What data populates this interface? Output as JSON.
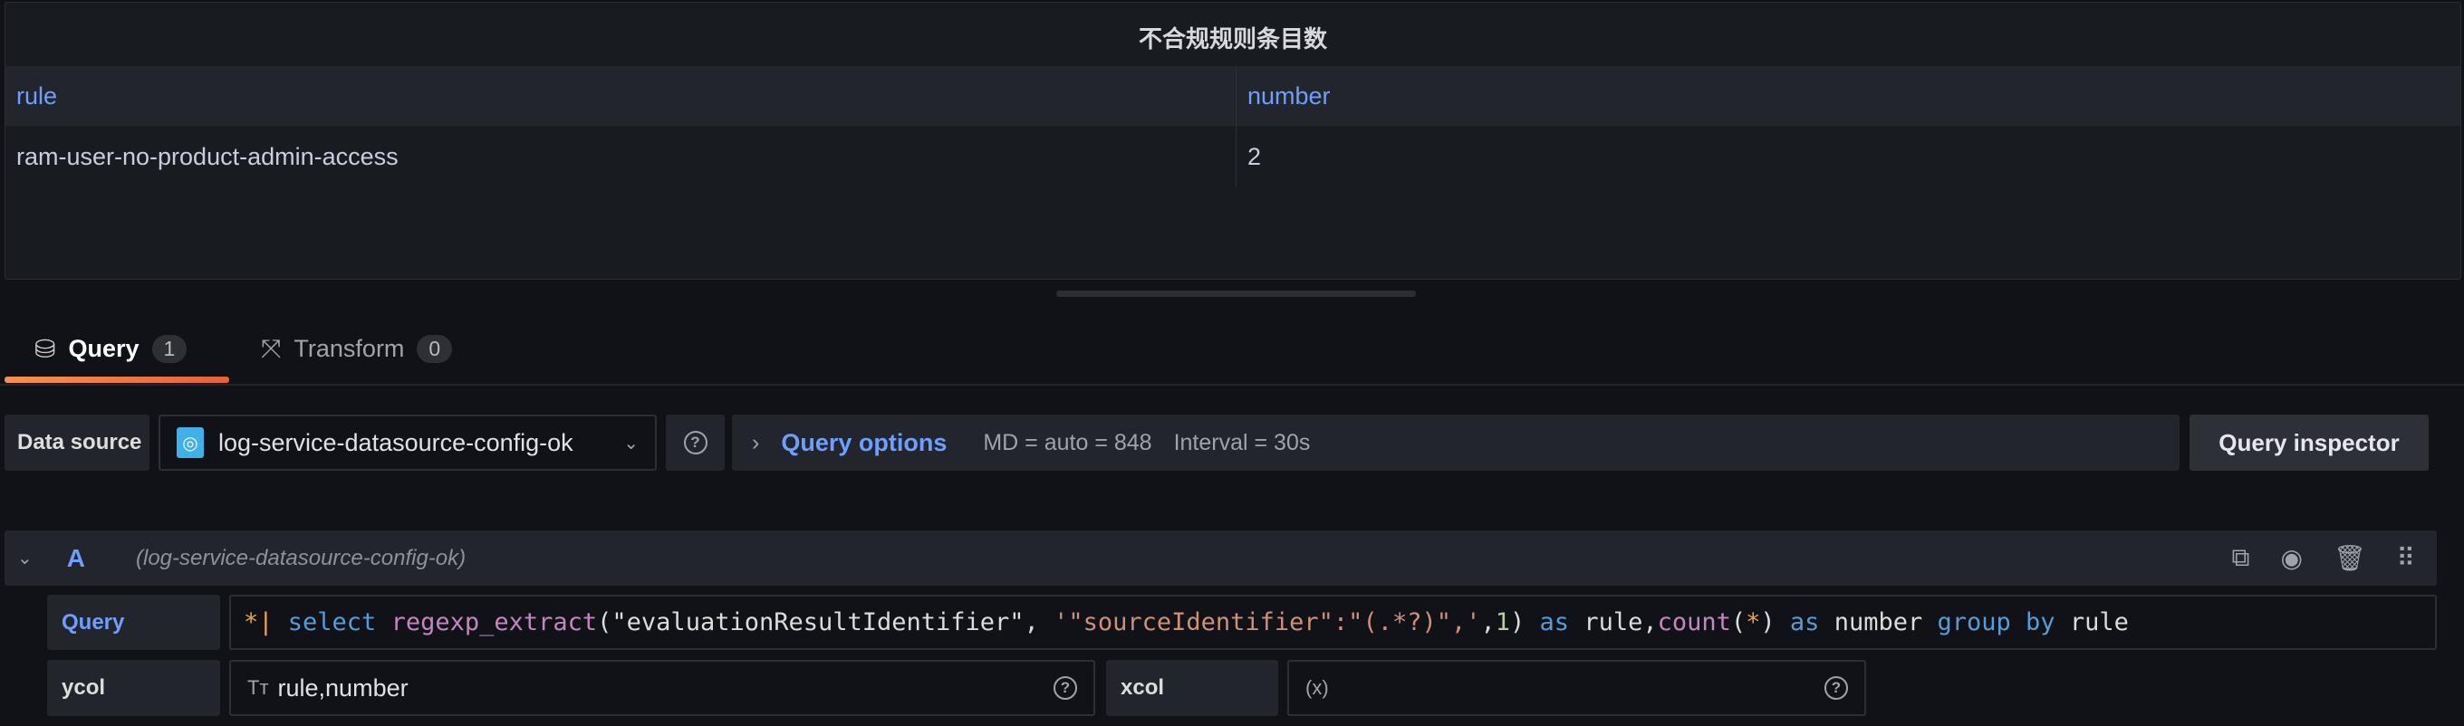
{
  "panel": {
    "title": "不合规规则条目数",
    "columns": [
      "rule",
      "number"
    ],
    "rows": [
      [
        "ram-user-no-product-admin-access",
        "2"
      ]
    ]
  },
  "tabs": [
    {
      "label": "Query",
      "count": "1"
    },
    {
      "label": "Transform",
      "count": "0"
    }
  ],
  "datasource": {
    "label": "Data source",
    "value": "log-service-datasource-config-ok"
  },
  "query_options": {
    "label": "Query options",
    "md": "MD = auto = 848",
    "interval": "Interval = 30s"
  },
  "inspector_label": "Query inspector",
  "query_row": {
    "letter": "A",
    "datasource": "(log-service-datasource-config-ok)"
  },
  "query_field": {
    "label": "Query",
    "tokens": [
      [
        "o",
        "*"
      ],
      [
        "o",
        "| "
      ],
      [
        "k",
        "select "
      ],
      [
        "f",
        "regexp_extract"
      ],
      [
        "w",
        "(\"evaluationResultIdentifier\", "
      ],
      [
        "s",
        "'\"sourceIdentifier\":\"(.*?)\",'"
      ],
      [
        "w",
        ","
      ],
      [
        "n",
        "1"
      ],
      [
        "w",
        ") "
      ],
      [
        "k",
        "as "
      ],
      [
        "w",
        "rule,"
      ],
      [
        "f",
        "count"
      ],
      [
        "w",
        "("
      ],
      [
        "o",
        "*"
      ],
      [
        "w",
        ") "
      ],
      [
        "k",
        "as "
      ],
      [
        "w",
        "number "
      ],
      [
        "k",
        "group by "
      ],
      [
        "w",
        "rule"
      ]
    ]
  },
  "ycol": {
    "label": "ycol",
    "value": "rule,number"
  },
  "xcol": {
    "label": "xcol",
    "value": ""
  }
}
